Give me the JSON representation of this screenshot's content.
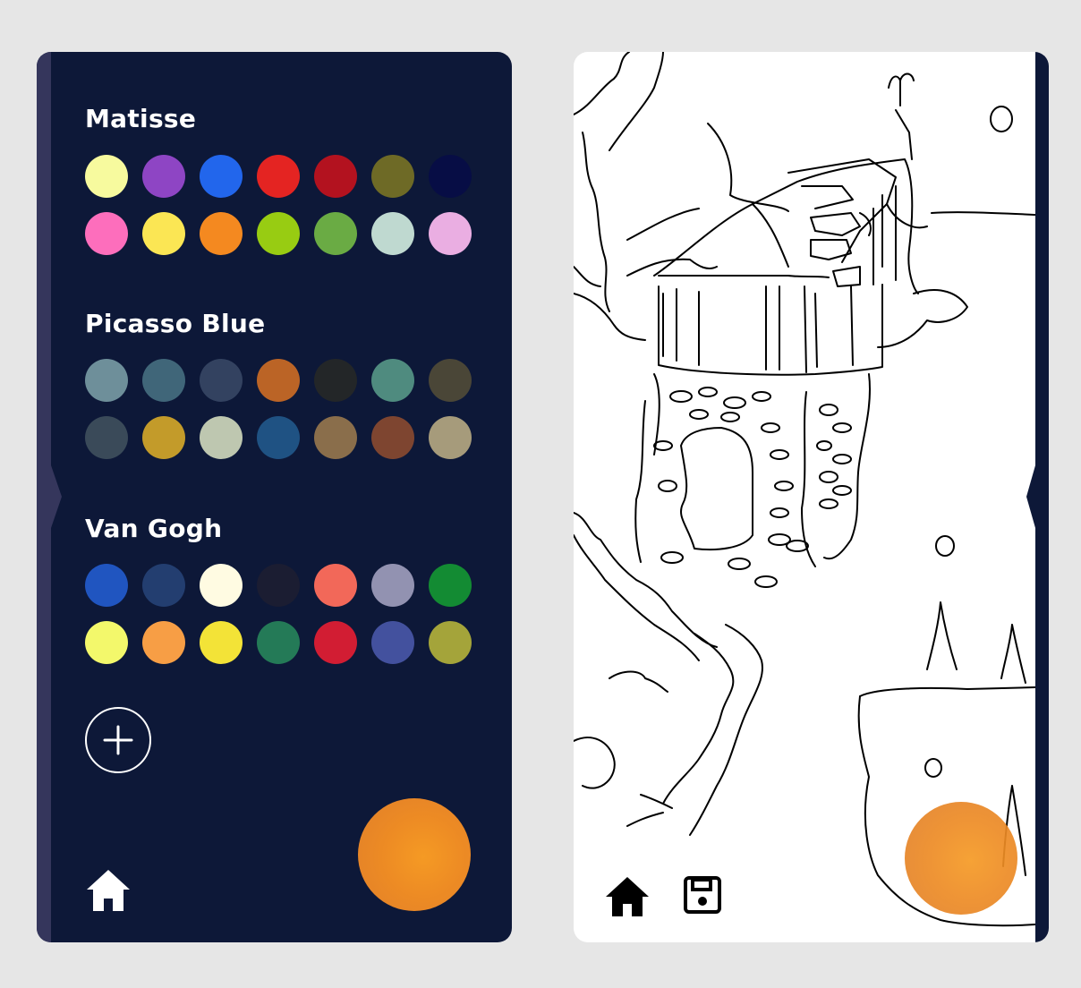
{
  "palettes": [
    {
      "name": "Matisse",
      "colors": [
        "#f7fa9e",
        "#8e45c4",
        "#2266ec",
        "#e42422",
        "#b3121f",
        "#6e6a26",
        "#070d45",
        "#fd6ebc",
        "#fbe654",
        "#f48920",
        "#98cc12",
        "#6aab44",
        "#bfd9d0",
        "#eaaee2"
      ]
    },
    {
      "name": "Picasso Blue",
      "colors": [
        "#6e8f9a",
        "#406679",
        "#334260",
        "#bb6426",
        "#232628",
        "#4f8b7f",
        "#4a4637",
        "#3a4a59",
        "#c39b2a",
        "#bec7b0",
        "#1f5283",
        "#8a6e4b",
        "#7e4530",
        "#a69b7b"
      ]
    },
    {
      "name": "Van Gogh",
      "colors": [
        "#2055c0",
        "#233e70",
        "#fffbe2",
        "#1b1d32",
        "#f26859",
        "#9292b1",
        "#138b33",
        "#f3f86b",
        "#f79e45",
        "#f3e337",
        "#247a57",
        "#d21d33",
        "#43519e",
        "#a4a43a"
      ]
    }
  ],
  "icons": {
    "add": "plus-icon",
    "home": "home-icon",
    "save": "floppy-disk-icon"
  },
  "colors": {
    "panel_background": "#0d1838",
    "panel_edge": "#35365c",
    "canvas_background": "#ffffff",
    "page_background": "#e6e6e6",
    "selected_color_orb": "#f08a24"
  }
}
